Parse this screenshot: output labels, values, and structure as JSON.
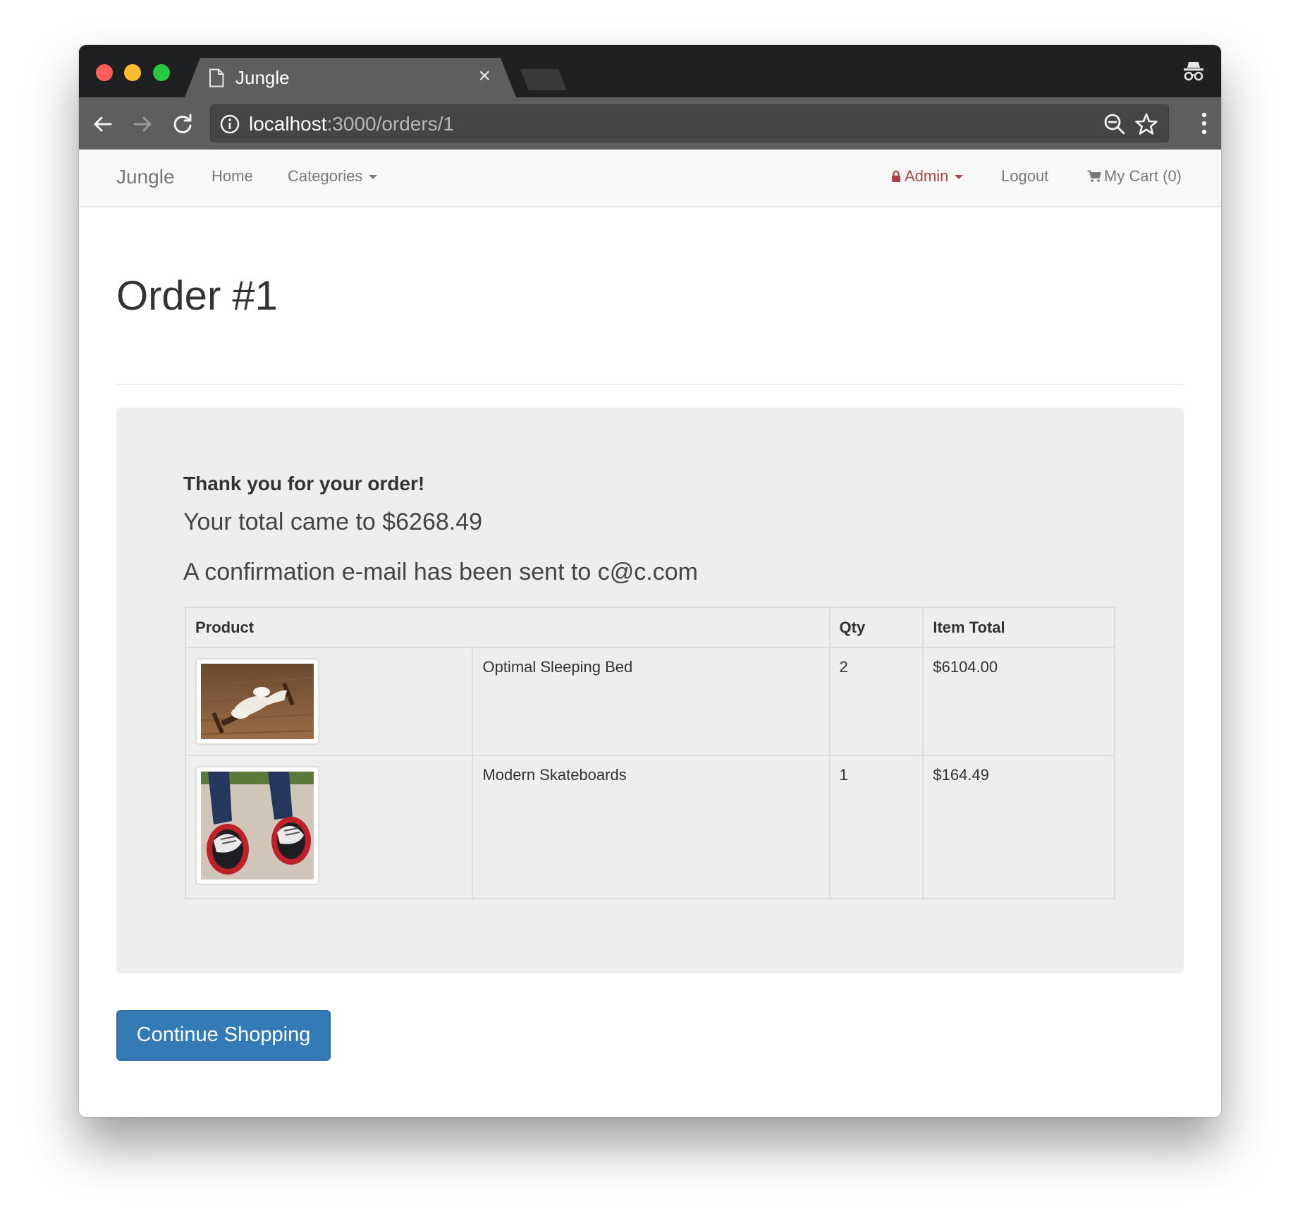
{
  "browser": {
    "tab_title": "Jungle",
    "tab_close": "×",
    "url_host": "localhost",
    "url_path": ":3000/orders/1"
  },
  "navbar": {
    "brand": "Jungle",
    "home": "Home",
    "categories": "Categories",
    "admin": "Admin",
    "logout": "Logout",
    "cart": "My Cart (0)"
  },
  "page": {
    "title": "Order #1",
    "thanks": "Thank you for your order!",
    "total_line": "Your total came to $6268.49",
    "email_line": "A confirmation e-mail has been sent to c@c.com"
  },
  "table": {
    "headers": {
      "product": "Product",
      "qty": "Qty",
      "item_total": "Item Total"
    },
    "rows": [
      {
        "name": "Optimal Sleeping Bed",
        "qty": "2",
        "total": "$6104.00",
        "image_icon": "bed-photo"
      },
      {
        "name": "Modern Skateboards",
        "qty": "1",
        "total": "$164.49",
        "image_icon": "skateboard-photo"
      }
    ]
  },
  "actions": {
    "continue_shopping": "Continue Shopping"
  },
  "colors": {
    "primary": "#337ab7",
    "admin": "#a94442",
    "well": "#eeeeee"
  }
}
